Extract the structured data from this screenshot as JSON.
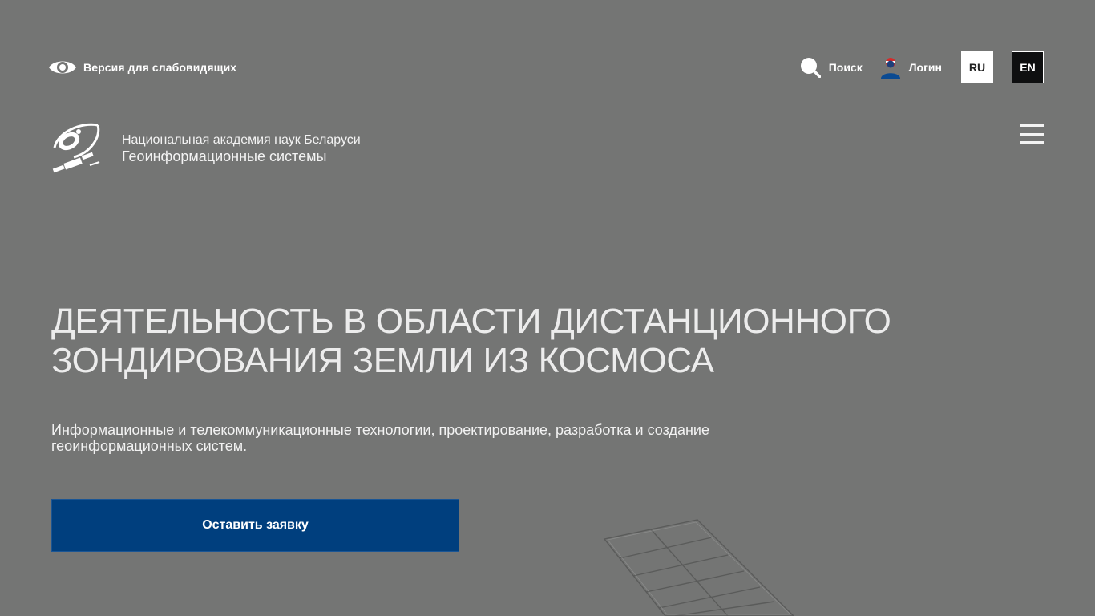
{
  "topbar": {
    "accessibility_label": "Версия для слабовидящих",
    "search_label": "Поиск",
    "login_label": "Логин",
    "lang_ru": "RU",
    "lang_en": "EN"
  },
  "brand": {
    "line1": "Национальная академия наук Беларуси",
    "line2": "Геоинформационные системы"
  },
  "hero": {
    "title": "ДЕЯТЕЛЬНОСТЬ В ОБЛАСТИ ДИСТАНЦИОННОГО ЗОНДИРОВАНИЯ ЗЕМЛИ ИЗ КОСМОСА",
    "subtitle": "Информационные и телекоммуникационные технологии, проектирование, разработка и создание геоинформационных систем.",
    "cta_label": "Оставить заявку"
  },
  "icons": {
    "accessibility": "eye-icon",
    "search": "search-icon",
    "login": "user-icon",
    "menu": "hamburger-menu-icon",
    "logo": "satellite-logo-icon"
  },
  "colors": {
    "background": "#747574",
    "cta": "#003f7e",
    "lang_active": "#ffffff",
    "lang_inactive": "#0e0f10"
  }
}
